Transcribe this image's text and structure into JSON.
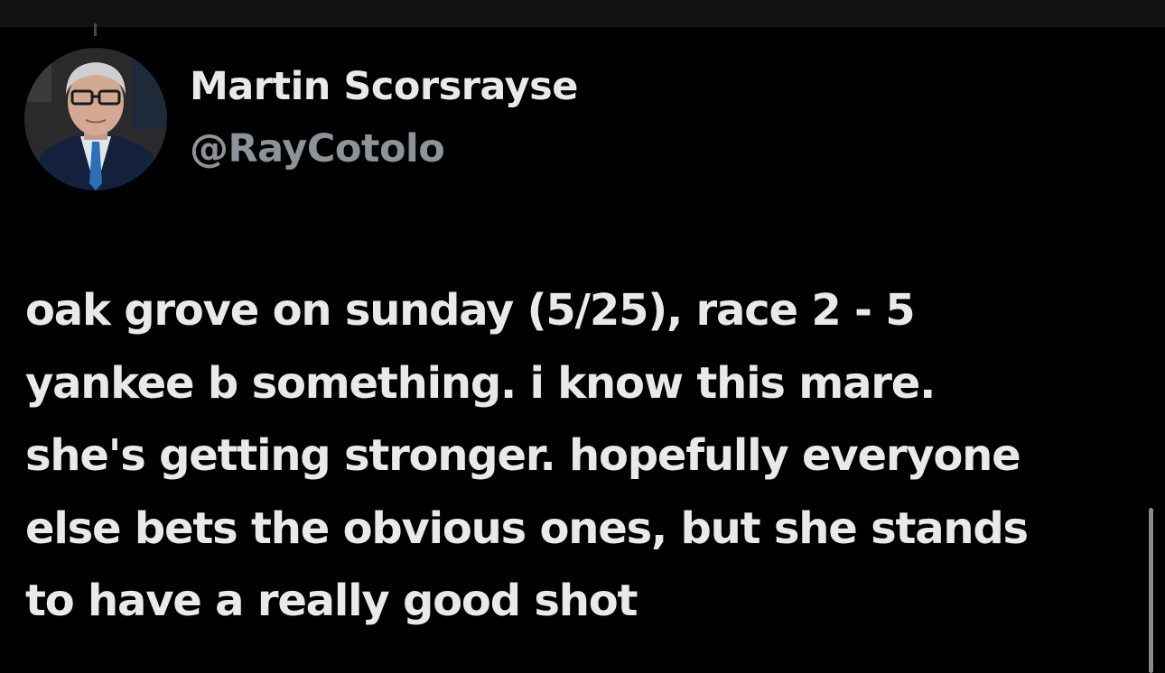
{
  "tweet": {
    "author": {
      "display_name": "Martin Scorsrayse",
      "handle": "@RayCotolo",
      "avatar_icon": "profile-photo-man-glasses-suit"
    },
    "text_lines": [
      "oak grove on sunday (5/25), race 2 - 5",
      "yankee b something. i know this mare.",
      "she's getting stronger. hopefully everyone",
      "else bets the obvious ones, but she stands",
      "to have a really good shot"
    ]
  },
  "colors": {
    "background": "#000000",
    "primary_text": "#e7e9ea",
    "secondary_text": "#8d9399"
  }
}
